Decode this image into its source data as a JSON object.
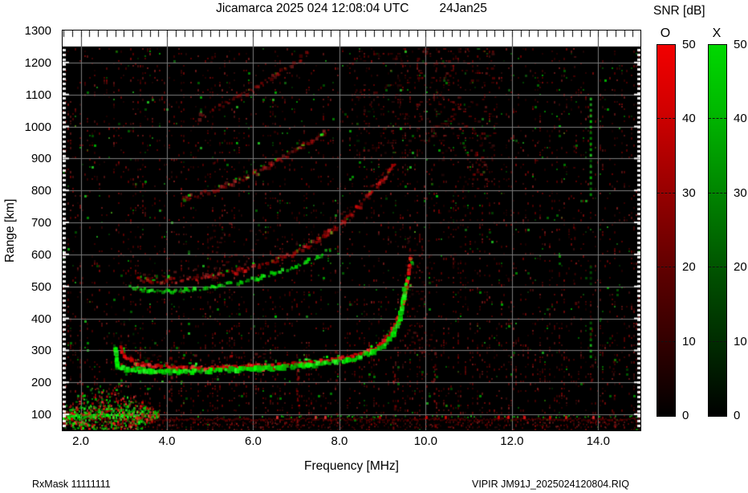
{
  "header": {
    "title_main": "Jicamarca 2025 024 12:08:04 UTC",
    "title_date": "24Jan25"
  },
  "footer": {
    "left": "RxMask 11111111",
    "right": "VIPIR  JM91J_2025024120804.RIQ"
  },
  "colorbar": {
    "title": "SNR [dB]",
    "ticks": [
      50,
      40,
      30,
      20,
      10,
      0
    ],
    "bars": [
      {
        "label": "O",
        "color": "#ee0000"
      },
      {
        "label": "X",
        "color": "#00d800"
      }
    ]
  },
  "chart_data": {
    "type": "heatmap",
    "title": "Jicamarca 2025 024 12:08:04 UTC 24Jan25",
    "xlabel": "Frequency [MHz]",
    "ylabel": "Range [km]",
    "xlim": [
      1.58,
      14.98
    ],
    "ylim": [
      50,
      1300
    ],
    "x_major_ticks": [
      2,
      4,
      6,
      8,
      10,
      12,
      14
    ],
    "x_tick_labels": [
      "2.0",
      "4.0",
      "6.0",
      "8.0",
      "10.0",
      "12.0",
      "14.0"
    ],
    "x_minor_step": 0.2,
    "y_ticks": [
      100,
      200,
      300,
      400,
      500,
      600,
      700,
      800,
      900,
      1000,
      1100,
      1200,
      1300
    ],
    "grid": true,
    "background": "#000000",
    "grid_color": "#7c7c7c",
    "data_top_km": 1250,
    "snr_range_db": [
      0,
      50
    ],
    "legend": {
      "O_mode_color": "red",
      "X_mode_color": "green",
      "position": "right"
    },
    "series": [
      {
        "name": "F-trace-X-mode",
        "color": "green",
        "width": 4,
        "alpha": 0.95,
        "gap": 0.07,
        "jitter": 2,
        "points": [
          [
            2.82,
            304
          ],
          [
            2.86,
            250
          ],
          [
            3.1,
            240
          ],
          [
            3.6,
            234
          ],
          [
            4.2,
            233
          ],
          [
            5.0,
            236
          ],
          [
            5.6,
            239
          ],
          [
            6.2,
            243
          ],
          [
            6.7,
            248
          ],
          [
            7.2,
            253
          ],
          [
            7.7,
            259
          ],
          [
            8.1,
            267
          ],
          [
            8.5,
            279
          ],
          [
            8.8,
            295
          ],
          [
            9.05,
            318
          ],
          [
            9.25,
            350
          ],
          [
            9.38,
            390
          ],
          [
            9.46,
            435
          ],
          [
            9.5,
            470
          ],
          [
            9.53,
            505
          ]
        ],
        "specks": {
          "color": "red",
          "density": 0.1,
          "spread": 8
        }
      },
      {
        "name": "F-trace-O-mode",
        "color": "red",
        "width": 3,
        "alpha": 0.9,
        "gap": 0.09,
        "jitter": 2,
        "points": [
          [
            2.92,
            312
          ],
          [
            3.02,
            278
          ],
          [
            3.3,
            258
          ],
          [
            3.8,
            249
          ],
          [
            4.4,
            246
          ],
          [
            5.2,
            246
          ],
          [
            6.0,
            250
          ],
          [
            6.6,
            254
          ],
          [
            7.1,
            259
          ],
          [
            7.6,
            265
          ],
          [
            8.0,
            273
          ],
          [
            8.4,
            285
          ],
          [
            8.75,
            301
          ],
          [
            9.0,
            323
          ],
          [
            9.2,
            355
          ],
          [
            9.35,
            395
          ],
          [
            9.45,
            438
          ],
          [
            9.53,
            482
          ],
          [
            9.6,
            540
          ],
          [
            9.64,
            592
          ]
        ],
        "band": {
          "up_km": 42,
          "density": 0.5,
          "alpha": 0.55,
          "fmax": 6.3
        },
        "specks": {
          "color": "green",
          "density": 0.18,
          "spread": 7
        }
      },
      {
        "name": "F-2nd-hop-X",
        "color": "green",
        "width": 3,
        "alpha": 0.8,
        "gap": 0.3,
        "jitter": 2,
        "points": [
          [
            3.15,
            497
          ],
          [
            3.6,
            488
          ],
          [
            4.1,
            485
          ],
          [
            4.6,
            490
          ],
          [
            5.1,
            499
          ],
          [
            5.6,
            511
          ],
          [
            6.1,
            526
          ],
          [
            6.6,
            545
          ],
          [
            7.1,
            568
          ],
          [
            7.5,
            592
          ],
          [
            7.8,
            616
          ]
        ]
      },
      {
        "name": "F-2nd-hop-O",
        "color": "red",
        "width": 3,
        "alpha": 0.55,
        "gap": 0.25,
        "jitter": 3,
        "points": [
          [
            3.3,
            522
          ],
          [
            3.9,
            516
          ],
          [
            4.5,
            521
          ],
          [
            5.1,
            533
          ],
          [
            5.7,
            549
          ],
          [
            6.3,
            571
          ],
          [
            6.9,
            601
          ],
          [
            7.4,
            636
          ],
          [
            7.9,
            681
          ],
          [
            8.4,
            742
          ],
          [
            8.9,
            812
          ],
          [
            9.3,
            886
          ]
        ],
        "band": {
          "up_km": 35,
          "density": 0.45,
          "alpha": 0.4,
          "fmax": 9.3
        },
        "specks": {
          "color": "green",
          "density": 0.12,
          "spread": 8
        }
      },
      {
        "name": "F-3rd-hop",
        "color": "red",
        "width": 3,
        "alpha": 0.45,
        "gap": 0.3,
        "jitter": 3,
        "points": [
          [
            4.35,
            772
          ],
          [
            4.9,
            793
          ],
          [
            5.4,
            816
          ],
          [
            5.9,
            844
          ],
          [
            6.4,
            878
          ],
          [
            6.9,
            916
          ],
          [
            7.4,
            956
          ],
          [
            7.75,
            990
          ]
        ],
        "band": {
          "up_km": 18,
          "density": 0.3,
          "alpha": 0.35,
          "fmax": 8.0
        },
        "specks": {
          "color": "green",
          "density": 0.22,
          "spread": 9
        }
      },
      {
        "name": "F-4th-hop",
        "color": "red",
        "width": 3,
        "alpha": 0.4,
        "gap": 0.35,
        "jitter": 3,
        "points": [
          [
            4.75,
            1028
          ],
          [
            5.2,
            1058
          ],
          [
            5.65,
            1090
          ],
          [
            6.1,
            1124
          ],
          [
            6.55,
            1162
          ],
          [
            6.95,
            1198
          ],
          [
            7.3,
            1232
          ]
        ],
        "specks": {
          "color": "green",
          "density": 0.12,
          "spread": 8
        }
      }
    ],
    "e_layer": {
      "green_line_km": 98,
      "red_line_km": 87,
      "bright_fmax": 3.35,
      "blob": {
        "f": [
          1.58,
          3.8
        ],
        "km": [
          60,
          250
        ],
        "peak_f": 2.6
      }
    },
    "clouds": [
      {
        "f": [
          9.55,
          10.15
        ],
        "km": [
          280,
          660
        ],
        "density": 0.09,
        "alpha": 0.3,
        "green": 0
      },
      {
        "f": [
          9.8,
          10.8
        ],
        "km": [
          950,
          1245
        ],
        "density": 0.16,
        "alpha": 0.38,
        "green": 0.06
      },
      {
        "f": [
          10.85,
          11.6
        ],
        "km": [
          800,
          1245
        ],
        "density": 0.13,
        "alpha": 0.38,
        "green": 0.12
      },
      {
        "f": [
          8.3,
          9.6
        ],
        "km": [
          900,
          1245
        ],
        "density": 0.09,
        "alpha": 0.3,
        "green": 0.1
      },
      {
        "f": [
          4.9,
          6.3
        ],
        "km": [
          560,
          700
        ],
        "density": 0.07,
        "alpha": 0.28,
        "green": 0
      },
      {
        "f": [
          2.55,
          3.45
        ],
        "km": [
          250,
          430
        ],
        "density": 0.06,
        "alpha": 0.3,
        "green": 0.25
      },
      {
        "f": [
          10.3,
          10.9
        ],
        "km": [
          560,
          950
        ],
        "density": 0.05,
        "alpha": 0.25,
        "green": 0
      }
    ],
    "rfi_columns": [
      {
        "f": 4.08,
        "km": [
          60,
          310
        ],
        "density": 0.3,
        "alpha": 0.45
      },
      {
        "f": 5.62,
        "km": [
          60,
          280
        ],
        "density": 0.18,
        "alpha": 0.35
      },
      {
        "f": 7.03,
        "km": [
          60,
          280
        ],
        "density": 0.4,
        "alpha": 0.6
      },
      {
        "f": 7.92,
        "km": [
          60,
          300
        ],
        "density": 0.22,
        "alpha": 0.4
      },
      {
        "f": 9.27,
        "km": [
          60,
          340
        ],
        "density": 0.32,
        "alpha": 0.5
      },
      {
        "f": 10.2,
        "km": [
          60,
          310
        ],
        "density": 0.3,
        "alpha": 0.55
      },
      {
        "f": 13.45,
        "km": [
          60,
          1250
        ],
        "density": 0.07,
        "alpha": 0.3
      },
      {
        "f": 13.84,
        "km": [
          60,
          460
        ],
        "density": 0.18,
        "alpha": 0.4
      },
      {
        "f": 14.37,
        "km": [
          60,
          320
        ],
        "density": 0.12,
        "alpha": 0.35
      },
      {
        "f": 5.05,
        "km": [
          60,
          1250
        ],
        "density": 0.04,
        "alpha": 0.25
      },
      {
        "f": 6.5,
        "km": [
          60,
          1250
        ],
        "density": 0.04,
        "alpha": 0.25
      },
      {
        "f": 8.6,
        "km": [
          60,
          1250
        ],
        "density": 0.04,
        "alpha": 0.25
      },
      {
        "f": 11.9,
        "km": [
          60,
          1250
        ],
        "density": 0.035,
        "alpha": 0.25
      },
      {
        "f": 12.6,
        "km": [
          60,
          1250
        ],
        "density": 0.035,
        "alpha": 0.25
      }
    ],
    "dashed_line": {
      "f": 13.82,
      "color": "green",
      "segments": [
        [
          280,
          390,
          0.45
        ],
        [
          500,
          565,
          0.25
        ],
        [
          790,
          1090,
          0.6
        ]
      ]
    },
    "noise": {
      "red_density": 0.085,
      "green_density": 0.011,
      "stripes": true
    }
  }
}
